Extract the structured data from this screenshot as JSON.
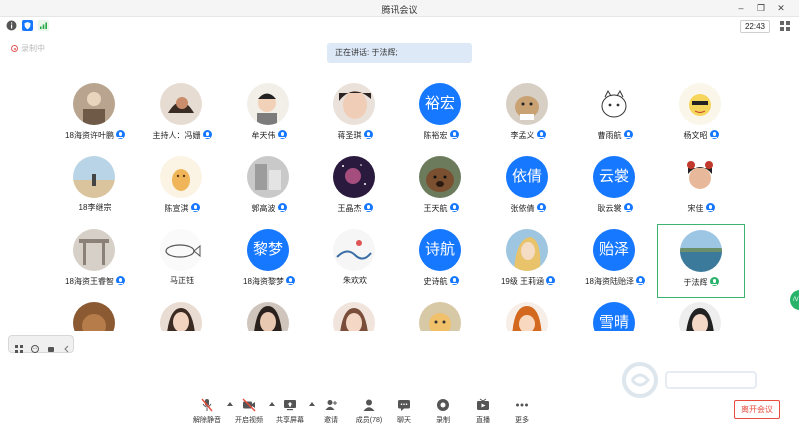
{
  "window": {
    "title": "腾讯会议"
  },
  "toolbar": {
    "clock": "22:43"
  },
  "recording": {
    "label": "录制中"
  },
  "speaking": {
    "text": "正在讲话: 于法辉;"
  },
  "participants": [
    {
      "name": "18海资许叶鹏",
      "mic": true,
      "avatar": "photo"
    },
    {
      "name": "主持人：冯姗",
      "mic": true,
      "avatar": "photo"
    },
    {
      "name": "牟天伟",
      "mic": true,
      "avatar": "photo"
    },
    {
      "name": "蒋圣琪",
      "mic": true,
      "avatar": "photo"
    },
    {
      "name": "陈裕宏",
      "mic": true,
      "avatar": "text",
      "avatar_text": "裕宏"
    },
    {
      "name": "李孟义",
      "mic": true,
      "avatar": "photo"
    },
    {
      "name": "曹雨航",
      "mic": true,
      "avatar": "photo"
    },
    {
      "name": "杨文昭",
      "mic": true,
      "avatar": "photo"
    },
    {
      "name": "18李继宗",
      "mic": false,
      "avatar": "photo"
    },
    {
      "name": "陈宣淇",
      "mic": true,
      "avatar": "photo"
    },
    {
      "name": "郭高波",
      "mic": true,
      "avatar": "photo"
    },
    {
      "name": "王晶杰",
      "mic": true,
      "avatar": "photo"
    },
    {
      "name": "王天航",
      "mic": true,
      "avatar": "photo"
    },
    {
      "name": "张依倩",
      "mic": true,
      "avatar": "text",
      "avatar_text": "依倩"
    },
    {
      "name": "耿云裳",
      "mic": true,
      "avatar": "text",
      "avatar_text": "云裳"
    },
    {
      "name": "宋佳",
      "mic": true,
      "avatar": "photo"
    },
    {
      "name": "18海资王睿智",
      "mic": true,
      "avatar": "photo"
    },
    {
      "name": "马正钰",
      "mic": false,
      "avatar": "photo"
    },
    {
      "name": "18海资黎梦",
      "mic": true,
      "avatar": "text",
      "avatar_text": "黎梦"
    },
    {
      "name": "朱欢欢",
      "mic": false,
      "avatar": "photo"
    },
    {
      "name": "史诗航",
      "mic": true,
      "avatar": "text",
      "avatar_text": "诗航"
    },
    {
      "name": "19级 王莉涵",
      "mic": true,
      "avatar": "photo"
    },
    {
      "name": "18海资陆贻泽",
      "mic": true,
      "avatar": "text",
      "avatar_text": "贻泽"
    },
    {
      "name": "于法辉",
      "mic": true,
      "avatar": "photo",
      "active": true
    },
    {
      "name": "",
      "mic": false,
      "avatar": "photo"
    },
    {
      "name": "",
      "mic": false,
      "avatar": "photo"
    },
    {
      "name": "",
      "mic": false,
      "avatar": "photo"
    },
    {
      "name": "",
      "mic": false,
      "avatar": "photo"
    },
    {
      "name": "",
      "mic": false,
      "avatar": "photo"
    },
    {
      "name": "",
      "mic": false,
      "avatar": "photo"
    },
    {
      "name": "",
      "mic": false,
      "avatar": "text",
      "avatar_text": "雪晴"
    },
    {
      "name": "",
      "mic": false,
      "avatar": "photo"
    }
  ],
  "bottombar": {
    "unmute": "解除静音",
    "video": "开启视频",
    "share": "共享屏幕",
    "invite": "邀请",
    "members": "成员(78)",
    "chat": "聊天",
    "record": "录制",
    "live": "直播",
    "more": "更多",
    "leave": "离开会议"
  },
  "colors": {
    "accent": "#1677ff",
    "active_border": "#3cb371",
    "leave": "#e74c3c"
  }
}
